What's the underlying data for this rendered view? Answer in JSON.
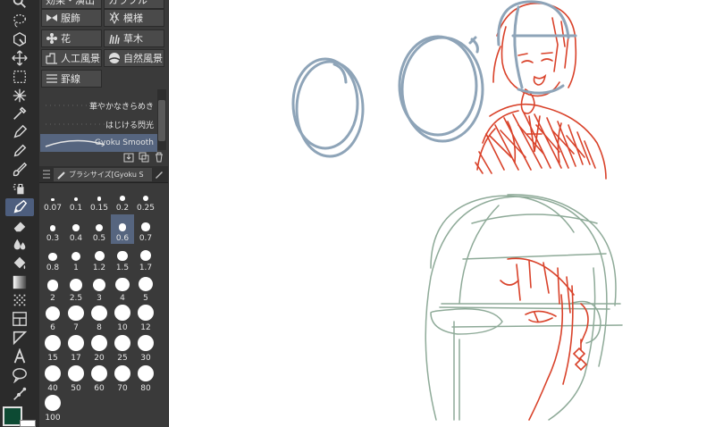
{
  "colors": {
    "main": "#0d4a33",
    "sub": "#ffffff",
    "sketch_blue": "#8ea4b8",
    "sketch_red": "#d9422a",
    "sketch_green": "#8eaa98"
  },
  "toolbar": {
    "tools": [
      {
        "name": "zoom-tool"
      },
      {
        "name": "lasso-select-tool"
      },
      {
        "name": "object-tool"
      },
      {
        "name": "move-tool"
      },
      {
        "name": "rect-select-tool"
      },
      {
        "name": "auto-select-tool"
      },
      {
        "name": "eyedropper-tool"
      },
      {
        "name": "pen-tool"
      },
      {
        "name": "pencil-tool"
      },
      {
        "name": "brush-tool"
      },
      {
        "name": "airbrush-tool"
      },
      {
        "name": "decoration-tool",
        "active": true
      },
      {
        "name": "eraser-tool"
      },
      {
        "name": "blend-tool"
      },
      {
        "name": "fill-tool"
      },
      {
        "name": "gradient-tool"
      },
      {
        "name": "tone-tool"
      },
      {
        "name": "frame-tool"
      },
      {
        "name": "ruler-tool"
      },
      {
        "name": "text-tool"
      },
      {
        "name": "balloon-tool"
      },
      {
        "name": "correct-line-tool"
      }
    ]
  },
  "materials": {
    "top_partial": [
      "効果・演出",
      "カラフル"
    ],
    "buttons": [
      {
        "label": "服飾",
        "icon": "bow-icon"
      },
      {
        "label": "模様",
        "icon": "pattern-icon"
      },
      {
        "label": "花",
        "icon": "flower-icon"
      },
      {
        "label": "草木",
        "icon": "grass-icon"
      },
      {
        "label": "人工風景",
        "icon": "building-icon"
      },
      {
        "label": "自然風景",
        "icon": "landscape-icon"
      },
      {
        "label": "罫線",
        "icon": "ruled-lines-icon"
      }
    ]
  },
  "brushes": {
    "items": [
      {
        "label": "華やかなきらめき",
        "selected": false
      },
      {
        "label": "はじける閃光",
        "selected": false
      },
      {
        "label": "Gyoku Smooth",
        "selected": true
      }
    ]
  },
  "brush_size": {
    "tab_label": "ブラシサイズ[Gyoku S",
    "selected": "0.6",
    "sizes": [
      "0.07",
      "0.1",
      "0.15",
      "0.2",
      "0.25",
      "0.3",
      "0.4",
      "0.5",
      "0.6",
      "0.7",
      "0.8",
      "1",
      "1.2",
      "1.5",
      "1.7",
      "2",
      "2.5",
      "3",
      "4",
      "5",
      "6",
      "7",
      "8",
      "10",
      "12",
      "15",
      "17",
      "20",
      "25",
      "30",
      "40",
      "50",
      "60",
      "70",
      "80",
      "100"
    ]
  }
}
